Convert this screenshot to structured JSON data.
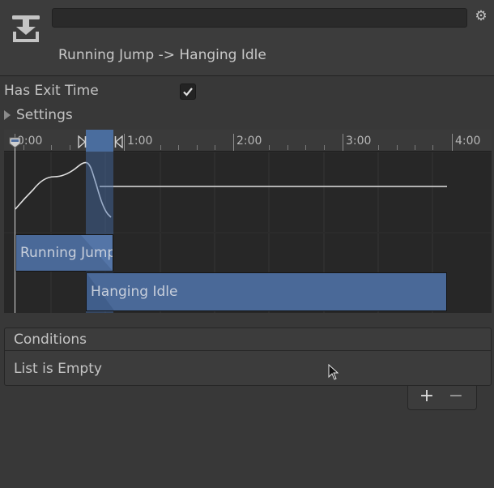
{
  "header": {
    "name_value": "",
    "title": "Running Jump -> Hanging Idle"
  },
  "properties": {
    "has_exit_time_label": "Has Exit Time",
    "has_exit_time_checked": true,
    "settings_label": "Settings",
    "settings_expanded": false
  },
  "timeline": {
    "ruler_labels": [
      "0:00",
      "1:00",
      "2:00",
      "3:00",
      "4:00"
    ],
    "clips": [
      {
        "label": "Running Jump"
      },
      {
        "label": "Hanging Idle"
      }
    ]
  },
  "conditions": {
    "title": "Conditions",
    "empty_text": "List is Empty",
    "add_label": "+",
    "remove_label": "−"
  },
  "icons": {
    "transition": "transition-icon",
    "settings": "gear-icon",
    "checkbox": "checkmark-icon",
    "foldout": "triangle-right-icon",
    "cursor": "mouse-cursor-icon"
  },
  "colors": {
    "background": "#383838",
    "clip": "#4a6998",
    "overlap": "#4a6d9e",
    "text": "#c4c4c4"
  }
}
